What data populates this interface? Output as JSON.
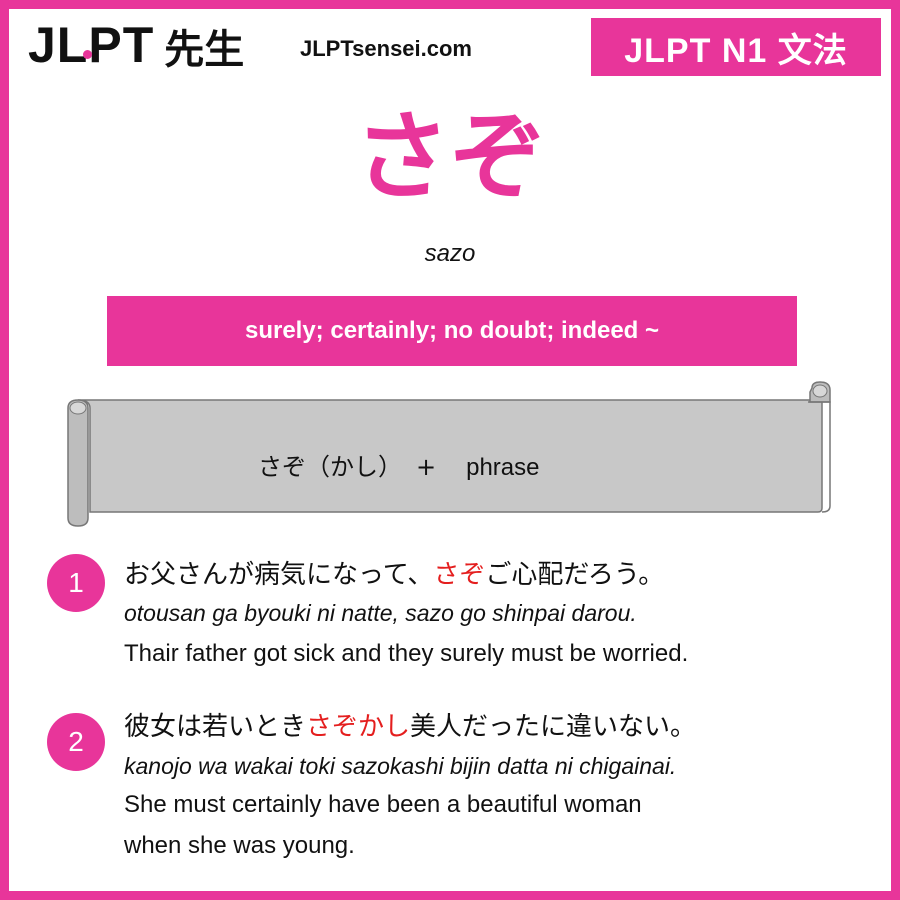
{
  "header": {
    "logo_jlpt": "JLPT",
    "logo_sensei": "先生",
    "site_url": "JLPTsensei.com",
    "level_badge": "JLPT N1 文法"
  },
  "grammar": {
    "title": "さぞ",
    "romaji": "sazo",
    "meaning": "surely; certainly; no doubt; indeed ~"
  },
  "formula": {
    "pattern": "さぞ（かし）",
    "plus": "+",
    "phrase": "phrase"
  },
  "examples": [
    {
      "number": "1",
      "jp_before": "お父さんが病気になって、",
      "jp_highlight": "さぞ",
      "jp_after": "ご心配だろう。",
      "romaji": "otousan ga byouki ni natte, sazo go shinpai darou.",
      "english_1": "Thair father got sick and they surely must be worried.",
      "english_2": ""
    },
    {
      "number": "2",
      "jp_before": "彼女は若いとき",
      "jp_highlight": "さぞかし",
      "jp_after": "美人だったに違いない。",
      "romaji": "kanojo wa wakai toki sazokashi bijin datta ni chigainai.",
      "english_1": "She must certainly have been a beautiful woman",
      "english_2": "when she was young."
    }
  ],
  "colors": {
    "brand_pink": "#e8359a",
    "highlight_red": "#e41e1e",
    "scroll_gray": "#c8c8c8"
  }
}
